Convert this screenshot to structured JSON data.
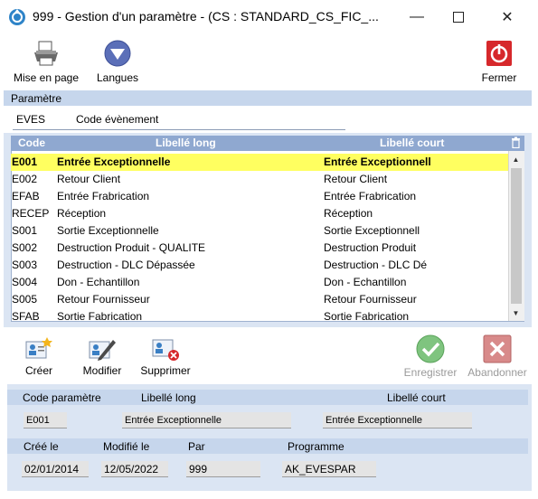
{
  "window": {
    "title": "999 - Gestion d'un paramètre - (CS : STANDARD_CS_FIC_..."
  },
  "toolbar": {
    "page_setup": "Mise en page",
    "languages": "Langues",
    "close": "Fermer"
  },
  "parameter": {
    "section_title": "Paramètre",
    "code": "EVES",
    "label": "Code évènement"
  },
  "grid": {
    "headers": {
      "code": "Code",
      "long": "Libellé long",
      "short": "Libellé court"
    },
    "rows": [
      {
        "code": "E001",
        "long": "Entrée Exceptionnelle",
        "short": "Entrée Exceptionnell"
      },
      {
        "code": "E002",
        "long": "Retour Client",
        "short": "Retour Client"
      },
      {
        "code": "EFAB",
        "long": "Entrée Frabrication",
        "short": "Entrée Frabrication"
      },
      {
        "code": "RECEP",
        "long": "Réception",
        "short": "Réception"
      },
      {
        "code": "S001",
        "long": "Sortie Exceptionnelle",
        "short": "Sortie Exceptionnell"
      },
      {
        "code": "S002",
        "long": "Destruction Produit - QUALITE",
        "short": "Destruction Produit"
      },
      {
        "code": "S003",
        "long": "Destruction - DLC Dépassée",
        "short": "Destruction - DLC Dé"
      },
      {
        "code": "S004",
        "long": "Don - Echantillon",
        "short": "Don - Echantillon"
      },
      {
        "code": "S005",
        "long": "Retour Fournisseur",
        "short": "Retour Fournisseur"
      },
      {
        "code": "SFAB",
        "long": "Sortie Fabrication",
        "short": "Sortie Fabrication"
      }
    ]
  },
  "actions": {
    "create": "Créer",
    "modify": "Modifier",
    "delete": "Supprimer",
    "save": "Enregistrer",
    "cancel": "Abandonner"
  },
  "detail": {
    "code_label": "Code paramètre",
    "long_label": "Libellé long",
    "short_label": "Libellé court",
    "code": "E001",
    "long": "Entrée Exceptionnelle",
    "short": "Entrée Exceptionnelle",
    "created_label": "Créé le",
    "modified_label": "Modifié le",
    "by_label": "Par",
    "program_label": "Programme",
    "created": "02/01/2014",
    "modified": "12/05/2022",
    "by": "999",
    "program": "AK_EVESPAR"
  },
  "icons": [
    "app-icon",
    "printer-icon",
    "languages-icon",
    "power-icon",
    "trash-icon",
    "create-icon",
    "modify-icon",
    "delete-icon",
    "save-icon",
    "cancel-icon"
  ],
  "colors": {
    "selected_row": "#ffff60",
    "grid_header": "#8fa8d0",
    "panel": "#dbe5f3",
    "close_red": "#d6282b",
    "save_green": "#4aa84a"
  }
}
